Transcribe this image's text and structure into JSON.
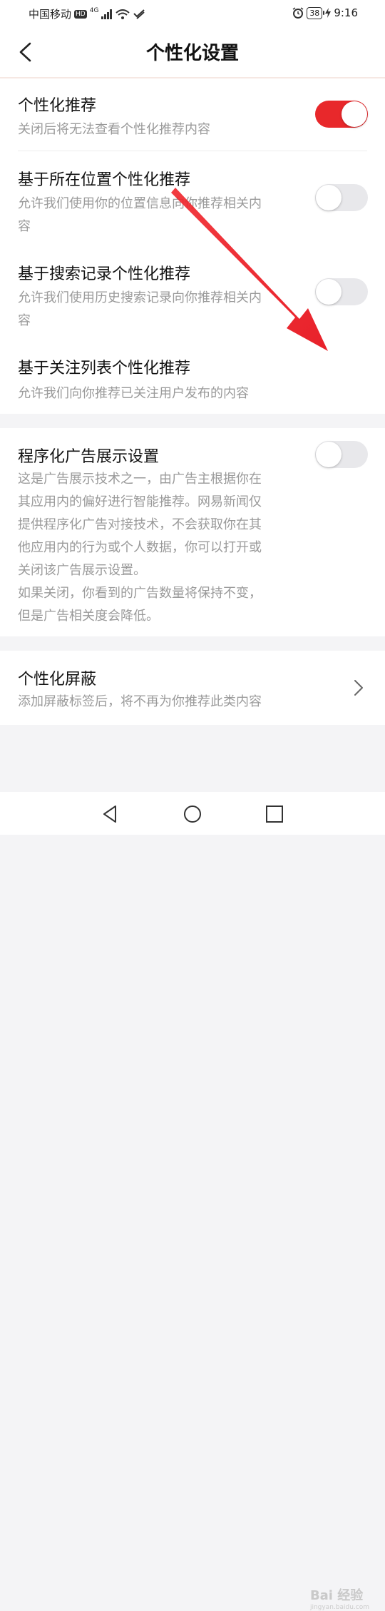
{
  "status_bar": {
    "carrier": "中国移动",
    "hd": "HD",
    "network": "4G",
    "battery": "38",
    "time": "9:16"
  },
  "header": {
    "title": "个性化设置"
  },
  "section1": {
    "items": [
      {
        "title": "个性化推荐",
        "desc": "关闭后将无法查看个性化推荐内容",
        "toggle": "on"
      },
      {
        "title": "基于所在位置个性化推荐",
        "desc_line1": "允许我们使用你的位置信息向你推荐相关内",
        "desc_line2": "容",
        "toggle": "off"
      },
      {
        "title": "基于搜索记录个性化推荐",
        "desc_line1": "允许我们使用历史搜索记录向你推荐相关内",
        "desc_line2": "容",
        "toggle": "off"
      },
      {
        "title": "基于关注列表个性化推荐",
        "desc": "允许我们向你推荐已关注用户发布的内容",
        "toggle": "on"
      }
    ]
  },
  "section2": {
    "title": "程序化广告展示设置",
    "toggle": "off",
    "desc_lines": [
      "这是广告展示技术之一，由广告主根据你在",
      "其应用内的偏好进行智能推荐。网易新闻仅",
      "提供程序化广告对接技术，不会获取你在其",
      "他应用内的行为或个人数据，你可以打开或",
      "关闭该广告展示设置。"
    ],
    "note_lines": [
      "如果关闭，你看到的广告数量将保持不变，",
      "但是广告相关度会降低。"
    ]
  },
  "section3": {
    "title": "个性化屏蔽",
    "desc": "添加屏蔽标签后，将不再为你推荐此类内容"
  },
  "colors": {
    "accent": "#e8282b",
    "toggle_off": "#e8e8eb",
    "annotation_arrow": "#e8212a"
  },
  "watermark": {
    "text": "Bai 经验",
    "sub": "jingyan.baidu.com"
  }
}
